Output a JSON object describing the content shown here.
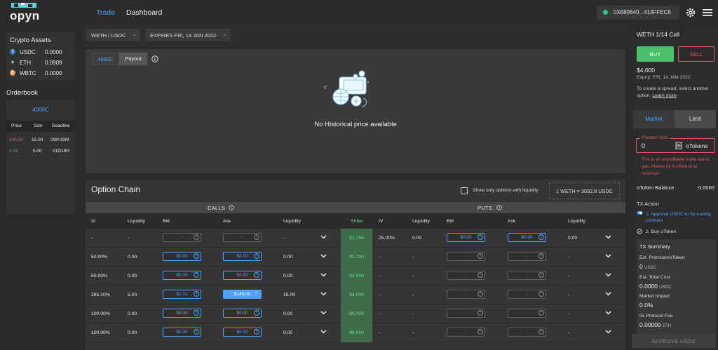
{
  "app": {
    "logo_text": "opyn"
  },
  "nav": {
    "trade": "Trade",
    "dashboard": "Dashboard",
    "wallet_address": "0X689640...414FFEC8",
    "wallet_status_color": "#27d07a",
    "accent": "#4da3ff"
  },
  "assets": {
    "title": "Crypto Assets",
    "items": [
      {
        "symbol": "USDC",
        "value": "0.0000",
        "icon": "usdc-icon"
      },
      {
        "symbol": "ETH",
        "value": "0.0909",
        "icon": "eth-icon"
      },
      {
        "symbol": "WBTC",
        "value": "0.0000",
        "icon": "wbtc-icon"
      }
    ]
  },
  "orderbook": {
    "title": "Orderbook",
    "strike": "4000C",
    "headers": [
      "Price",
      "Size",
      "Deadline"
    ],
    "rows": [
      {
        "price": "145.00",
        "size": "15.00",
        "deadline": "09H:30M",
        "side": "ask"
      },
      {
        "price": "1.01",
        "size": "5.00",
        "deadline": "01D18H",
        "side": "bid"
      }
    ]
  },
  "filters": {
    "pair": "WETH / USDC",
    "expiry": "EXPIRES FRI, 14 JAN 2022"
  },
  "chart": {
    "tab_strike": "4000C",
    "tab_payout": "Payout",
    "empty_message": "No Historical price available"
  },
  "chain": {
    "title": "Option Chain",
    "liquidity_toggle": "Show only options with liquidity",
    "rate": "1 WETH = 3032.8 USDC",
    "calls_label": "CALLS",
    "puts_label": "PUTS",
    "headers": {
      "iv": "IV",
      "liquidity": "Liquidity",
      "bid": "Bid",
      "ask": "Ask",
      "strike": "Strike"
    },
    "rows": [
      {
        "strike": "$2,750",
        "c_iv": "-",
        "c_liq": "-",
        "c_bid": "-",
        "c_ask": "-",
        "c_liq2": "-",
        "p_iv": "25.00%",
        "p_liq": "0.00",
        "p_bid": "$0.00",
        "p_ask": "$0.00",
        "p_liq2": "0.00"
      },
      {
        "strike": "$3,700",
        "c_iv": "50.00%",
        "c_liq": "0.00",
        "c_bid": "$0.00",
        "c_ask": "$0.00",
        "c_liq2": "0.00",
        "p_iv": "-",
        "p_liq": "-",
        "p_bid": "-",
        "p_ask": "-",
        "p_liq2": "-"
      },
      {
        "strike": "$3,900",
        "c_iv": "50.00%",
        "c_liq": "0.00",
        "c_bid": "$0.00",
        "c_ask": "$0.00",
        "c_liq2": "0.00",
        "p_iv": "-",
        "p_liq": "-",
        "p_bid": "-",
        "p_ask": "-",
        "p_liq2": "-"
      },
      {
        "strike": "$4,000",
        "c_iv": "265.10%",
        "c_liq": "5.00",
        "c_bid": "$1.01",
        "c_ask": "$145.00",
        "c_liq2": "15.00",
        "p_iv": "-",
        "p_liq": "-",
        "p_bid": "-",
        "p_ask": "-",
        "p_liq2": "-"
      },
      {
        "strike": "$5,000",
        "c_iv": "100.00%",
        "c_liq": "0.00",
        "c_bid": "$0.00",
        "c_ask": "$0.00",
        "c_liq2": "0.00",
        "p_iv": "-",
        "p_liq": "-",
        "p_bid": "-",
        "p_ask": "-",
        "p_liq2": "-"
      },
      {
        "strike": "$6,000",
        "c_iv": "100.00%",
        "c_liq": "0.00",
        "c_bid": "$0.00",
        "c_ask": "$0.00",
        "c_liq2": "0.00",
        "p_iv": "-",
        "p_liq": "-",
        "p_bid": "-",
        "p_ask": "-",
        "p_liq2": "-"
      }
    ]
  },
  "trade": {
    "title": "WETH 1/14 Call",
    "buy": "BUY",
    "sell": "SELL",
    "price": "$4,000",
    "expiry": "Expiry: FRI, 14 JAN 2022",
    "spread_note": "To create a spread, select another option.",
    "learn_more": "Learn more",
    "tab_market": "Market",
    "tab_limit": "Limit",
    "position_label": "Position Size",
    "position_value": "0",
    "position_unit": "oTokens",
    "error": "This is an unprofitable trade due to gas. Please try 5 oTokens at minimum",
    "balance_label": "oToken Balance",
    "balance_value": "0.0000",
    "tx_action_label": "TX Action",
    "tx_step1": "1. Approve USDC to 0x trading contract",
    "tx_step2": "2. Buy oToken",
    "summary_title": "TX Summary",
    "premium_label": "Est. Premium/oToken",
    "premium_value": "0",
    "premium_unit": "USDC",
    "total_label": "Est. Total Cost",
    "total_value": "0.0000",
    "total_unit": "USDC",
    "impact_label": "Market Impact",
    "impact_value": "0.0%",
    "fee_label": "0x Protocol Fee",
    "fee_value": "0.00000",
    "fee_unit": "ETH",
    "approve": "APPROVE USDC"
  }
}
